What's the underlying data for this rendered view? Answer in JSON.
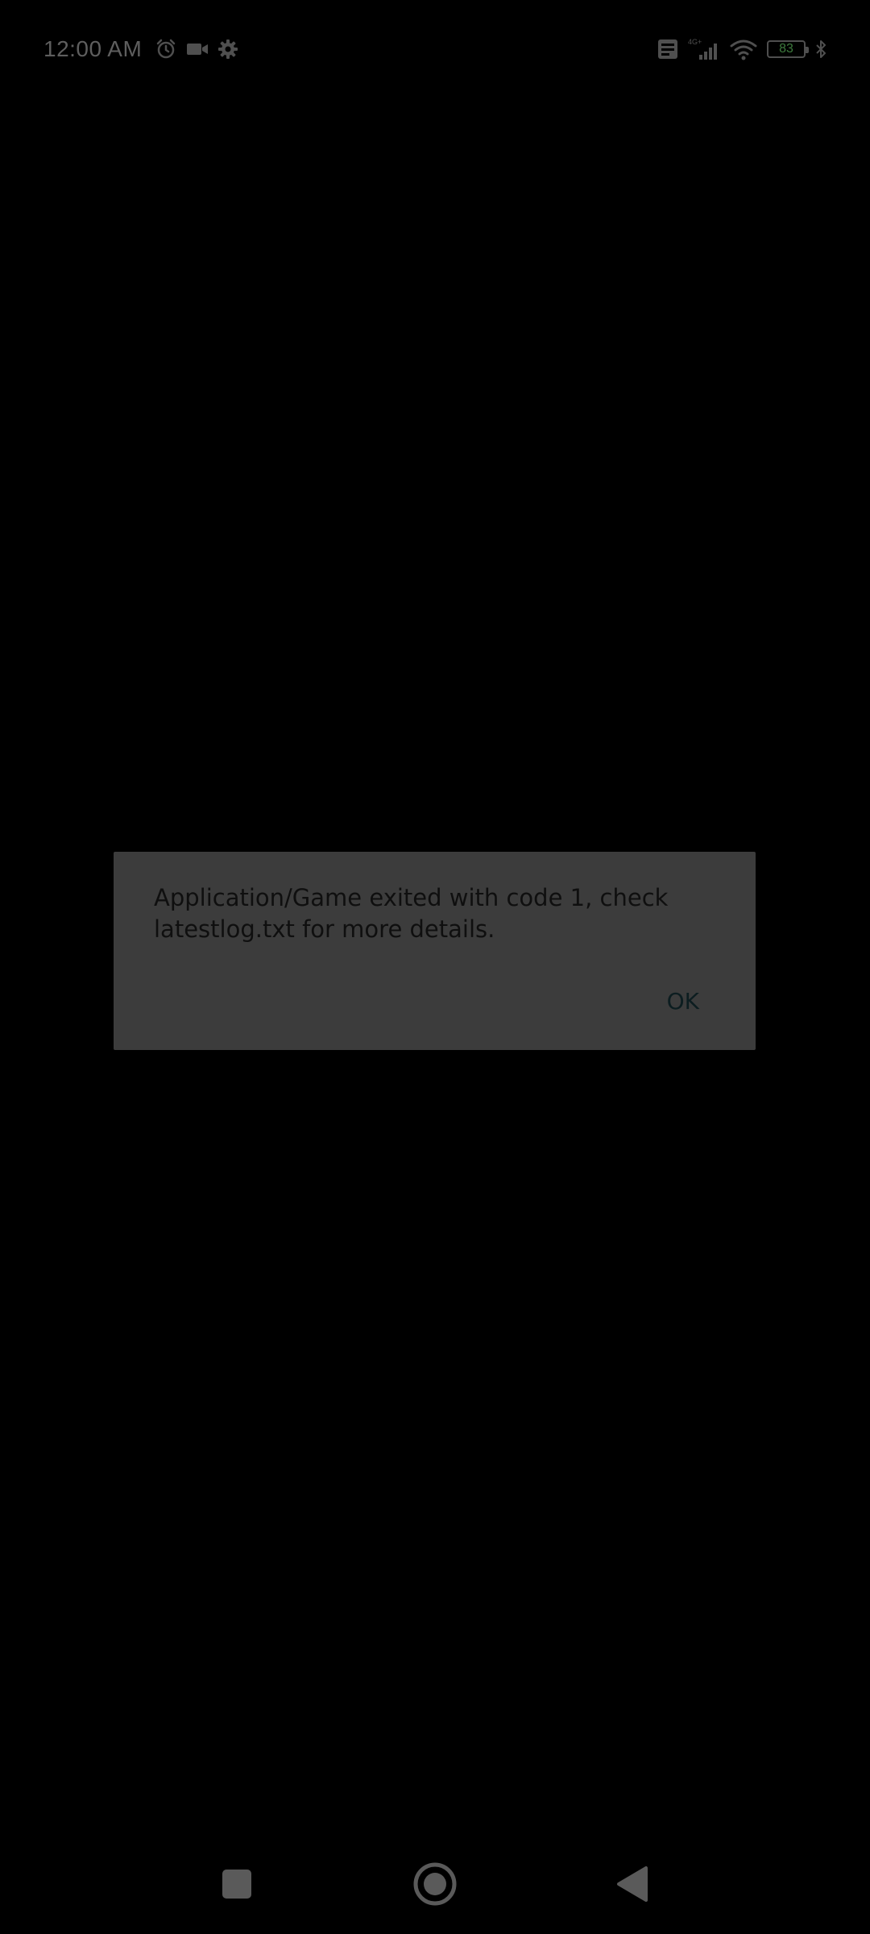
{
  "status_bar": {
    "time": "12:00 AM",
    "left_icons": [
      "alarm-icon",
      "video-camera-icon",
      "settings-gear-icon"
    ],
    "right_icons": [
      "volte-icon",
      "mobile-signal-icon",
      "wifi-icon",
      "battery-icon",
      "bluetooth-icon"
    ],
    "network_label": "4G+",
    "battery_level": "83"
  },
  "dialog": {
    "message": "Application/Game exited with code 1, check latestlog.txt for more details.",
    "ok_label": "OK"
  },
  "nav_bar": {
    "buttons": [
      "recents-button",
      "home-button",
      "back-button"
    ]
  },
  "colors": {
    "background": "#000000",
    "dialog_background": "#3c3c3c",
    "dialog_text": "#0f0f0f",
    "status_icons": "#4f4f4f"
  }
}
